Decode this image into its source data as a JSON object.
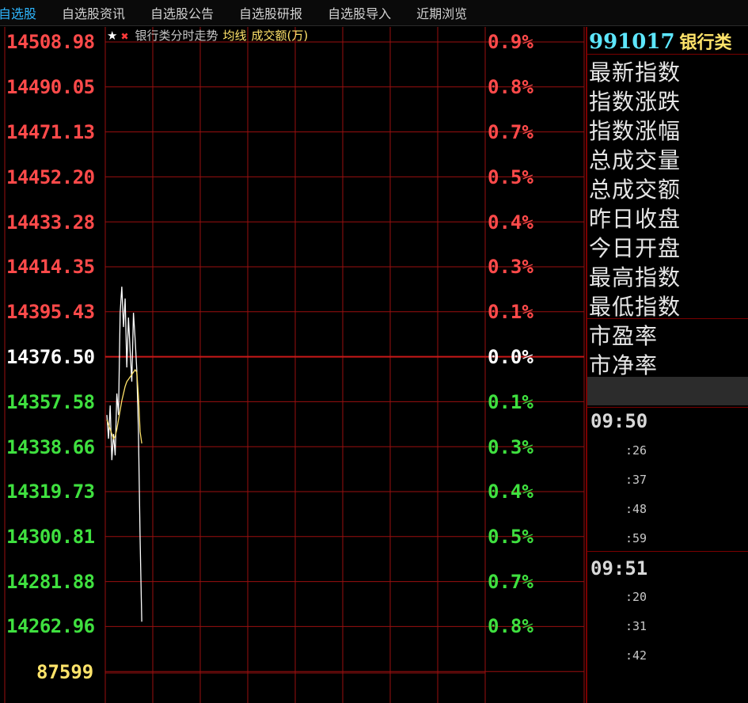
{
  "tabs": [
    {
      "label": "自选股",
      "active": true
    },
    {
      "label": "自选股资讯",
      "active": false
    },
    {
      "label": "自选股公告",
      "active": false
    },
    {
      "label": "自选股研报",
      "active": false
    },
    {
      "label": "自选股导入",
      "active": false
    },
    {
      "label": "近期浏览",
      "active": false
    }
  ],
  "chart": {
    "title": "银行类分时走势",
    "avg_label": "均线",
    "amount_label": "成交额(万)",
    "price_ticks": [
      "14508.98",
      "14490.05",
      "14471.13",
      "14452.20",
      "14433.28",
      "14414.35",
      "14395.43",
      "14376.50",
      "14357.58",
      "14338.66",
      "14319.73",
      "14300.81",
      "14281.88",
      "14262.96"
    ],
    "pct_ticks": [
      "0.9%",
      "0.8%",
      "0.7%",
      "0.5%",
      "0.4%",
      "0.3%",
      "0.1%",
      "0.0%",
      "0.1%",
      "0.3%",
      "0.4%",
      "0.5%",
      "0.7%",
      "0.8%"
    ],
    "volume_max": "87599",
    "colors": {
      "up": "#ff4a4a",
      "down": "#3fe03f",
      "grid": "#9a0f0f",
      "price_line": "#ffffff",
      "avg_line": "#ffe36a"
    }
  },
  "chart_data": {
    "type": "line",
    "title": "银行类分时走势",
    "ylim": [
      14262.96,
      14508.98
    ],
    "series": [
      {
        "name": "",
        "values": [
          14352,
          14342,
          14356,
          14333,
          14344,
          14335,
          14361,
          14352,
          14395,
          14406,
          14389,
          14401,
          14372,
          14393,
          14379,
          14366,
          14395,
          14384,
          14371,
          14345,
          14300,
          14265
        ]
      },
      {
        "name": "均线",
        "values": [
          14350,
          14348,
          14346,
          14344,
          14342,
          14343,
          14346,
          14350,
          14354,
          14358,
          14361,
          14364,
          14366,
          14367,
          14368,
          14369,
          14370,
          14371,
          14370,
          14360,
          14345,
          14340
        ]
      }
    ]
  },
  "panel": {
    "code": "991017",
    "name": "银行类",
    "labels": [
      "最新指数",
      "指数涨跌",
      "指数涨幅",
      "总成交量",
      "总成交额",
      "昨日收盘",
      "今日开盘",
      "最高指数",
      "最低指数"
    ],
    "ratios": [
      "市盈率",
      "市净率"
    ],
    "time_groups": [
      {
        "time": "09:50",
        "subs": [
          ":26",
          ":37",
          ":48",
          ":59"
        ]
      },
      {
        "time": "09:51",
        "subs": [
          ":20",
          ":31",
          ":42"
        ]
      }
    ]
  }
}
